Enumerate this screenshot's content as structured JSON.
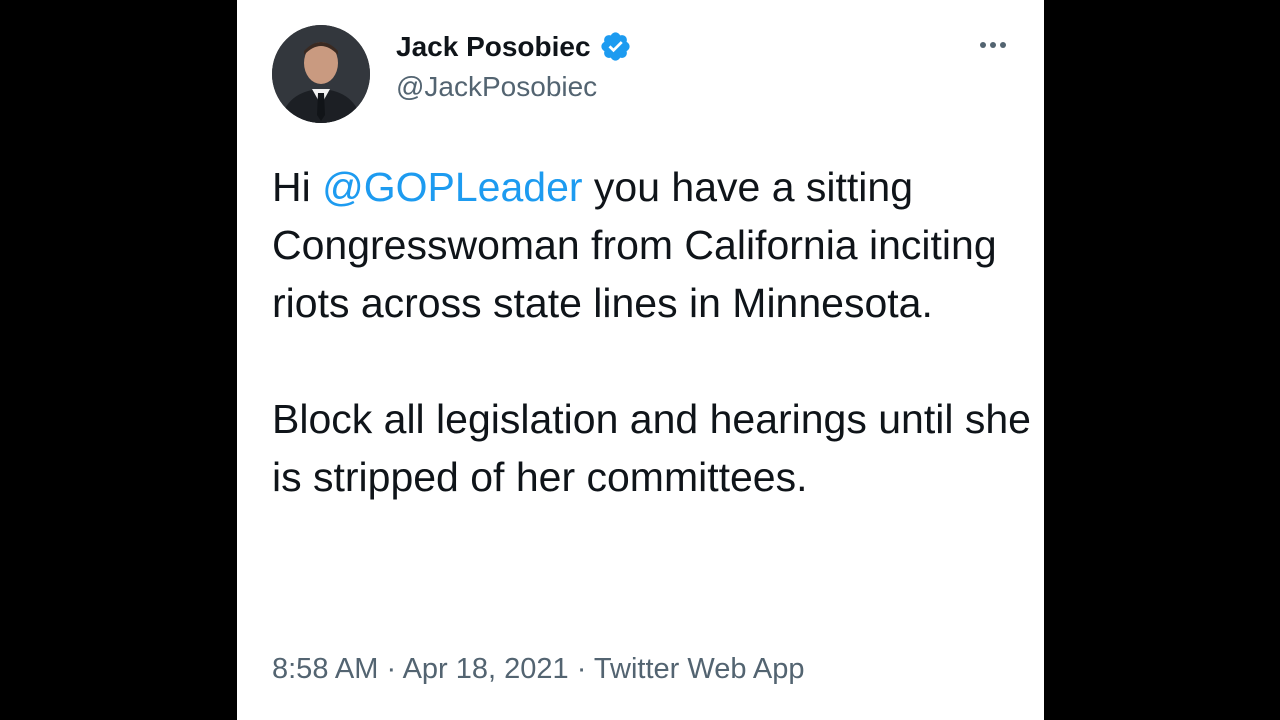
{
  "tweet": {
    "author": {
      "name": "Jack Posobiec",
      "handle": "@JackPosobiec",
      "verified": true,
      "avatar_icon": "profile-photo"
    },
    "more_icon": "more-options-icon",
    "body": {
      "p1_prefix": "Hi ",
      "mention": "@GOPLeader",
      "p1_rest": " you have a sitting Congresswoman from California inciting riots across state lines in Minnesota.",
      "p2": "Block all legislation and hearings until she is stripped of her committees."
    },
    "meta": {
      "time": "8:58 AM",
      "sep1": " · ",
      "date": "Apr 18, 2021",
      "sep2": " · ",
      "source": "Twitter Web App"
    },
    "colors": {
      "text": "#0f1419",
      "secondary": "#536471",
      "accent": "#1d9bf0"
    }
  }
}
